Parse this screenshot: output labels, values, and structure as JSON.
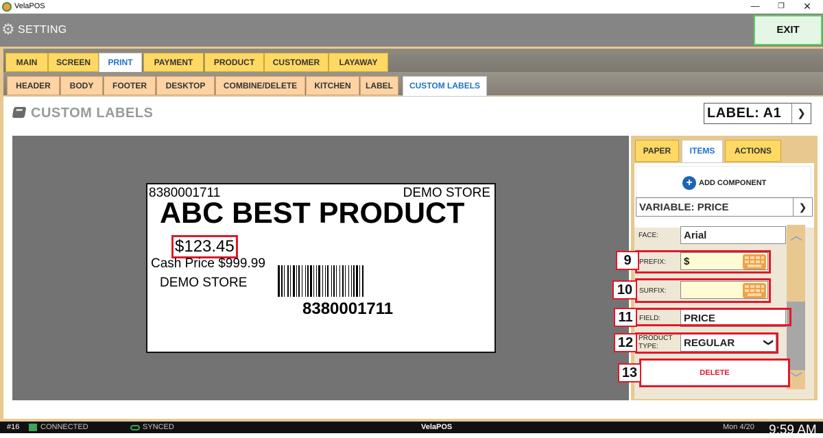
{
  "window": {
    "title": "VelaPOS",
    "min_glyph": "—",
    "max_glyph": "❐",
    "close_glyph": "✕"
  },
  "header": {
    "title": "SETTING",
    "exit_label": "EXIT"
  },
  "main_tabs": [
    {
      "label": "MAIN",
      "active": false
    },
    {
      "label": "SCREEN",
      "active": false
    },
    {
      "label": "PRINT",
      "active": true
    },
    {
      "label": "PAYMENT",
      "active": false
    },
    {
      "label": "PRODUCT",
      "active": false
    },
    {
      "label": "CUSTOMER",
      "active": false
    },
    {
      "label": "LAYAWAY",
      "active": false
    }
  ],
  "sub_tabs": [
    {
      "label": "HEADER",
      "active": false
    },
    {
      "label": "BODY",
      "active": false
    },
    {
      "label": "FOOTER",
      "active": false
    },
    {
      "label": "DESKTOP",
      "active": false
    },
    {
      "label": "COMBINE/DELETE",
      "active": false
    },
    {
      "label": "KITCHEN",
      "active": false
    },
    {
      "label": "LABEL",
      "active": false
    },
    {
      "label": "CUSTOM LABELS",
      "active": true
    }
  ],
  "page": {
    "title": "CUSTOM LABELS",
    "label_select": "LABEL: A1"
  },
  "label_preview": {
    "code_top": "8380001711",
    "store_top": "DEMO STORE",
    "product_name": "ABC BEST PRODUCT",
    "price": "$123.45",
    "cash_price": "Cash Price $999.99",
    "store_bottom": "DEMO STORE",
    "barcode_number": "8380001711"
  },
  "panel_tabs": [
    {
      "label": "PAPER",
      "active": false
    },
    {
      "label": "ITEMS",
      "active": true
    },
    {
      "label": "ACTIONS",
      "active": false
    }
  ],
  "panel": {
    "add_component": "ADD COMPONENT",
    "component_select": "VARIABLE: PRICE",
    "fields": {
      "face_label": "FACE:",
      "face_value": "Arial",
      "prefix_label": "PREFIX:",
      "prefix_value": "$",
      "surfix_label": "SURFIX:",
      "surfix_value": "",
      "field_label": "FIELD:",
      "field_value": "PRICE",
      "product_type_label_1": "PRODUCT",
      "product_type_label_2": "TYPE:",
      "product_type_value": "REGULAR"
    },
    "delete_label": "DELETE"
  },
  "callouts": {
    "n9": "9",
    "n10": "10",
    "n11": "11",
    "n12": "12",
    "n13": "13"
  },
  "taskbar": {
    "station": "#16",
    "connection": "CONNECTED",
    "sync": "SYNCED",
    "brand": "VelaPOS",
    "date": "Mon 4/20",
    "time": "9:59 AM"
  },
  "colors": {
    "highlight": "#e0182a",
    "tab": "#ffd964",
    "subtab": "#fdd3a3",
    "accent": "#1e73c8",
    "exit_border": "#5fd25f"
  }
}
